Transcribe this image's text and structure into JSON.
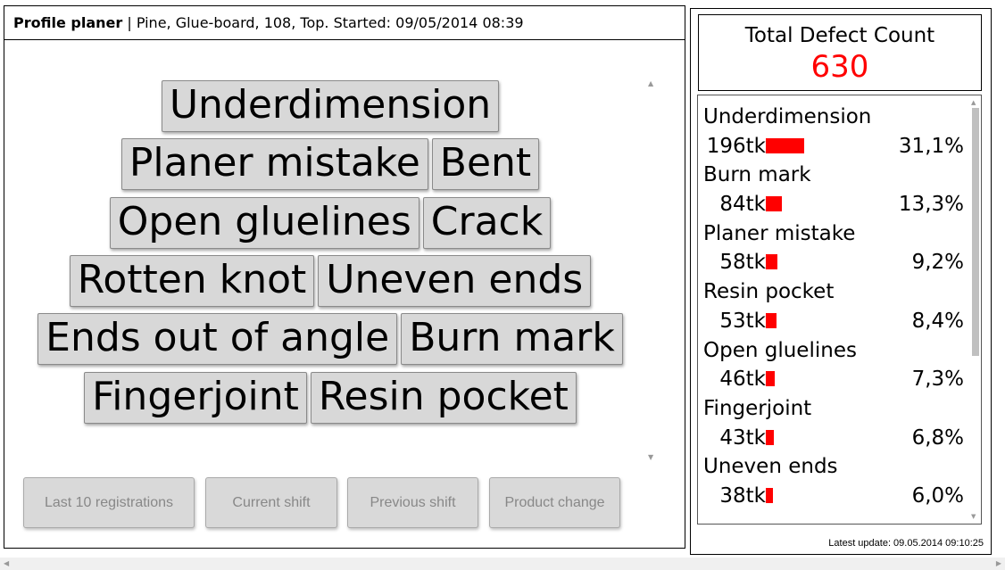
{
  "header": {
    "app_name": "Profile planer",
    "context": " | Pine, Glue-board, 108, Top. Started: 09/05/2014 08:39"
  },
  "defect_rows": [
    [
      "Underdimension"
    ],
    [
      "Planer mistake",
      "Bent"
    ],
    [
      "Open gluelines",
      "Crack"
    ],
    [
      "Rotten knot",
      "Uneven ends"
    ],
    [
      "Ends out of angle",
      "Burn mark"
    ],
    [
      "Fingerjoint",
      "Resin pocket"
    ]
  ],
  "bottom_buttons": {
    "last10": "Last 10 registrations",
    "current_shift": "Current shift",
    "previous_shift": "Previous shift",
    "product_change": "Product change"
  },
  "total": {
    "title": "Total Defect Count",
    "value": "630",
    "value_color": "#ff0000"
  },
  "stats": [
    {
      "name": "Underdimension",
      "count": "196tk",
      "pct": "31,1%",
      "fraction": 0.311
    },
    {
      "name": "Burn mark",
      "count": "84tk",
      "pct": "13,3%",
      "fraction": 0.133
    },
    {
      "name": "Planer mistake",
      "count": "58tk",
      "pct": "9,2%",
      "fraction": 0.092
    },
    {
      "name": "Resin pocket",
      "count": "53tk",
      "pct": "8,4%",
      "fraction": 0.084
    },
    {
      "name": "Open gluelines",
      "count": "46tk",
      "pct": "7,3%",
      "fraction": 0.073
    },
    {
      "name": "Fingerjoint",
      "count": "43tk",
      "pct": "6,8%",
      "fraction": 0.068
    },
    {
      "name": "Uneven ends",
      "count": "38tk",
      "pct": "6,0%",
      "fraction": 0.06
    }
  ],
  "latest_update": "Latest update: 09.05.2014 09:10:25",
  "bar_color": "#ff0000"
}
